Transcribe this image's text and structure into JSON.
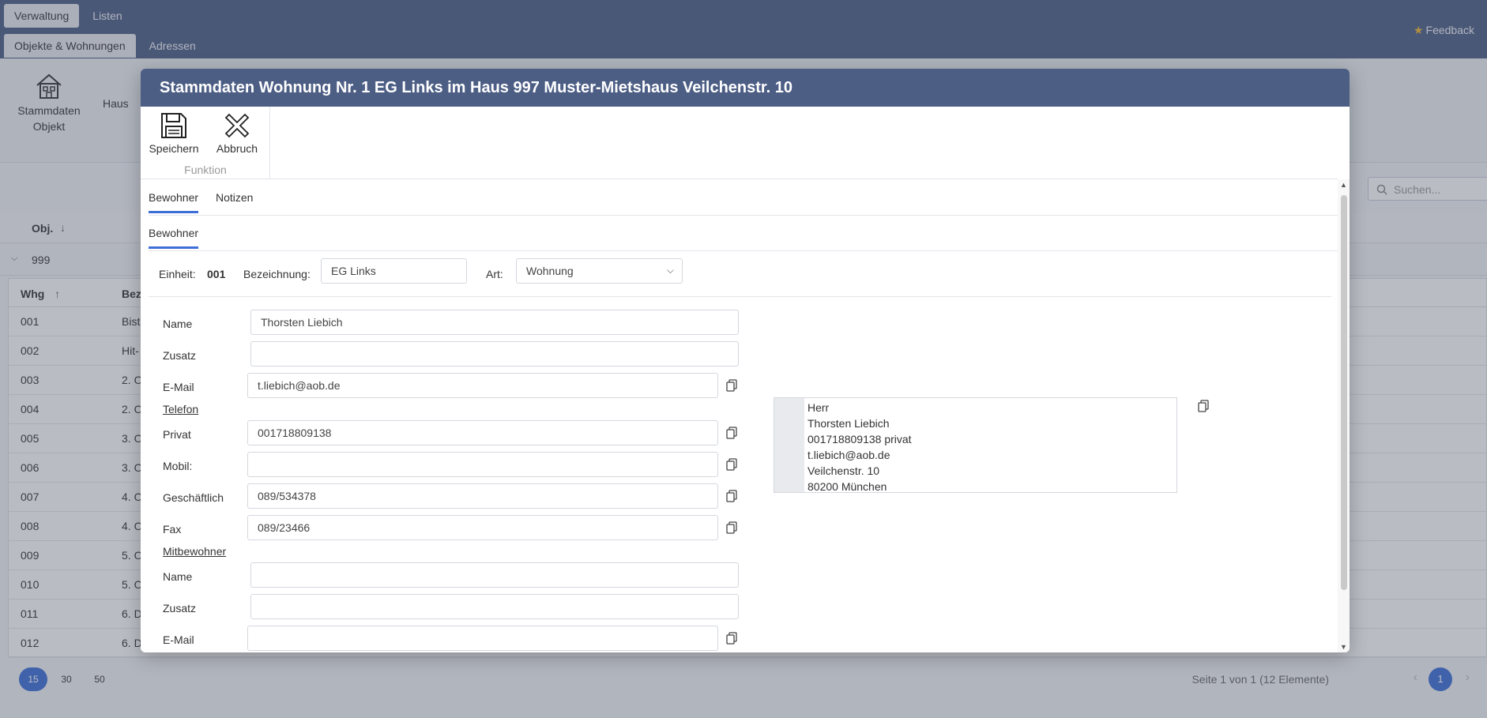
{
  "topnav": {
    "tabs": [
      "Verwaltung",
      "Listen"
    ],
    "feedback": "Feedback"
  },
  "subnav": {
    "tabs": [
      "Objekte & Wohnungen",
      "Adressen"
    ]
  },
  "ribbon": {
    "stammdaten_objekt": "Stammdaten Objekt",
    "haus_label": "Haus"
  },
  "search": {
    "placeholder": "Suchen..."
  },
  "grid": {
    "obj_header": "Obj.",
    "group_value": "999",
    "whg_header": "Whg",
    "bez_header": "Bez",
    "rows": [
      {
        "whg": "001",
        "bez": "Bist"
      },
      {
        "whg": "002",
        "bez": "Hit-"
      },
      {
        "whg": "003",
        "bez": "2. O"
      },
      {
        "whg": "004",
        "bez": "2. O"
      },
      {
        "whg": "005",
        "bez": "3. O"
      },
      {
        "whg": "006",
        "bez": "3. O"
      },
      {
        "whg": "007",
        "bez": "4. O"
      },
      {
        "whg": "008",
        "bez": "4. O"
      },
      {
        "whg": "009",
        "bez": "5. O"
      },
      {
        "whg": "010",
        "bez": "5. O"
      },
      {
        "whg": "011",
        "bez": "6. D"
      },
      {
        "whg": "012",
        "bez": "6. D"
      }
    ]
  },
  "pager": {
    "sizes": [
      "15",
      "30",
      "50"
    ],
    "active_size": "15",
    "info": "Seite 1 von 1 (12 Elemente)",
    "current_page": "1"
  },
  "modal": {
    "title": "Stammdaten Wohnung Nr. 1 EG Links im Haus 997 Muster-Mietshaus Veilchenstr. 10",
    "toolbar": {
      "save": "Speichern",
      "cancel": "Abbruch",
      "group": "Funktion"
    },
    "tabs": [
      "Bewohner",
      "Notizen"
    ],
    "subtab": "Bewohner",
    "einheit_label": "Einheit:",
    "einheit_value": "001",
    "bezeichnung_label": "Bezeichnung:",
    "bezeichnung_value": "EG Links",
    "art_label": "Art:",
    "art_value": "Wohnung",
    "form": {
      "name_label": "Name",
      "name_value": "Thorsten Liebich",
      "zusatz_label": "Zusatz",
      "zusatz_value": "",
      "email_label": "E-Mail",
      "email_value": "t.liebich@aob.de",
      "telefon_section": "Telefon",
      "privat_label": "Privat",
      "privat_value": "001718809138",
      "mobil_label": "Mobil:",
      "mobil_value": "",
      "geschaeftlich_label": "Geschäftlich",
      "geschaeftlich_value": "089/534378",
      "fax_label": "Fax",
      "fax_value": "089/23466",
      "mitbewohner_section": "Mitbewohner",
      "mb_name_label": "Name",
      "mb_name_value": "",
      "mb_zusatz_label": "Zusatz",
      "mb_zusatz_value": "",
      "mb_email_label": "E-Mail",
      "mb_email_value": ""
    },
    "address_lines": [
      "Herr",
      "Thorsten Liebich",
      "001718809138 privat",
      "t.liebich@aob.de",
      "Veilchenstr. 10",
      "80200 München"
    ]
  }
}
